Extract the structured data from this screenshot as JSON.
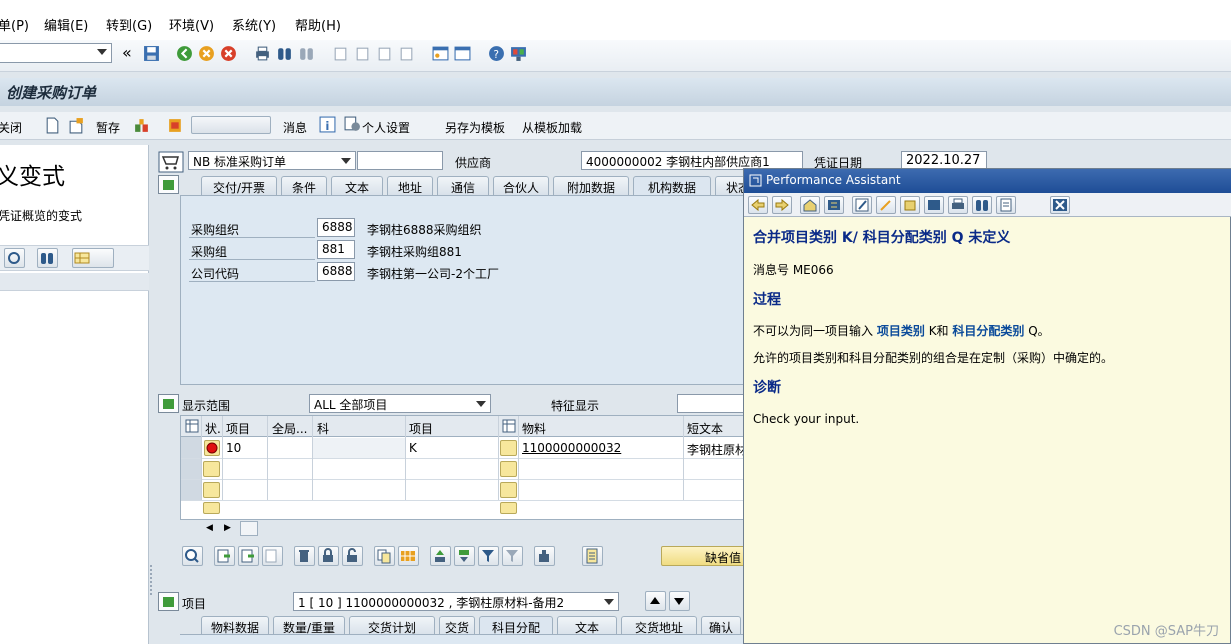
{
  "menu": [
    "单(P)",
    "编辑(E)",
    "转到(G)",
    "环境(V)",
    "系统(Y)",
    "帮助(H)"
  ],
  "screen": {
    "title": "创建采购订单"
  },
  "app_toolbar": {
    "close": "关闭",
    "hold": "暂存",
    "messages": "消息",
    "personal_settings": "个人设置",
    "save_as_template": "另存为模板",
    "load_from_template": "从模板加载"
  },
  "left_pane": {
    "title": "义变式",
    "subtitle": "凭证概览的变式"
  },
  "header": {
    "doc_type": "NB 标准采购订单",
    "supplier_label": "供应商",
    "supplier_value": "4000000002 李钢柱内部供应商1",
    "doc_date_label": "凭证日期",
    "doc_date_value": "2022.10.27",
    "tabs": [
      "交付/开票",
      "条件",
      "文本",
      "地址",
      "通信",
      "合伙人",
      "附加数据",
      "机构数据",
      "状态"
    ],
    "selected_tab": "机构数据",
    "org_fields": [
      {
        "label": "采购组织",
        "code": "6888",
        "desc": "李钢柱6888采购组织"
      },
      {
        "label": "采购组",
        "code": "881",
        "desc": "李钢柱采购组881"
      },
      {
        "label": "公司代码",
        "code": "6888",
        "desc": "李钢柱第一公司-2个工厂"
      }
    ]
  },
  "items": {
    "display_range_label": "显示范围",
    "display_range_value": "ALL 全部项目",
    "feature_label": "特征显示",
    "columns": [
      "状.",
      "项目",
      "全局...",
      "科",
      "项目",
      "物料",
      "短文本"
    ],
    "rows": [
      {
        "item": "10",
        "acct_cat": "",
        "item_cat": "K",
        "material": "1100000000032",
        "short_text": "李钢柱原材"
      }
    ],
    "default_button": "缺省值"
  },
  "item_detail": {
    "label": "项目",
    "selector": "1 [ 10 ] 1100000000032 , 李钢柱原材料-备用2",
    "tabs": [
      "物料数据",
      "数量/重量",
      "交货计划",
      "交货",
      "科目分配",
      "文本",
      "交货地址",
      "确认"
    ],
    "selected_tab": "科目分配"
  },
  "performance_assistant": {
    "title": "Performance Assistant",
    "heading": "合并项目类别 K/ 科目分配类别 Q 未定义",
    "message_no": "消息号 ME066",
    "procedure_heading": "过程",
    "procedure_text_1": "不可以为同一项目输入",
    "procedure_kw_1": "项目类别",
    "procedure_text_2": "K和",
    "procedure_kw_2": "科目分配类别",
    "procedure_text_3": "Q。",
    "procedure_text_4": "允许的项目类别和科目分配类别的组合是在定制（采购）中确定的。",
    "diagnosis_heading": "诊断",
    "diagnosis_text": "Check your input."
  },
  "watermark": "CSDN @SAP牛刀",
  "colors": {
    "accent": "#1e4d96",
    "keyword": "#0a4a9a",
    "assistant_bg": "#fbfae0"
  }
}
